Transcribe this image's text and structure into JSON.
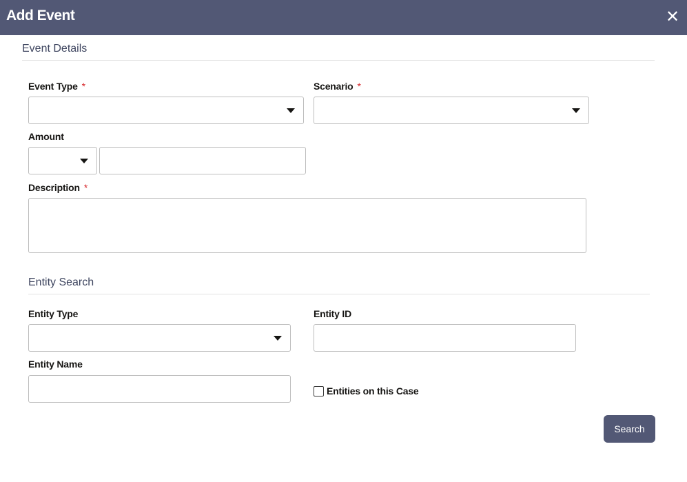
{
  "dialog": {
    "title": "Add Event",
    "close_icon": "close-icon"
  },
  "event_details": {
    "section_title": "Event Details",
    "event_type": {
      "label": "Event Type",
      "required_marker": "*",
      "value": ""
    },
    "scenario": {
      "label": "Scenario",
      "required_marker": "*",
      "value": ""
    },
    "amount": {
      "label": "Amount",
      "currency_value": "",
      "value": ""
    },
    "description": {
      "label": "Description",
      "required_marker": "*",
      "value": ""
    }
  },
  "entity_search": {
    "section_title": "Entity Search",
    "entity_type": {
      "label": "Entity Type",
      "value": ""
    },
    "entity_id": {
      "label": "Entity ID",
      "value": ""
    },
    "entity_name": {
      "label": "Entity Name",
      "value": ""
    },
    "entities_on_case": {
      "label": "Entities on this Case",
      "checked": false
    },
    "search_button": "Search"
  },
  "colors": {
    "header_bg": "#525875",
    "required": "#d6262a",
    "button_bg": "#525875"
  }
}
